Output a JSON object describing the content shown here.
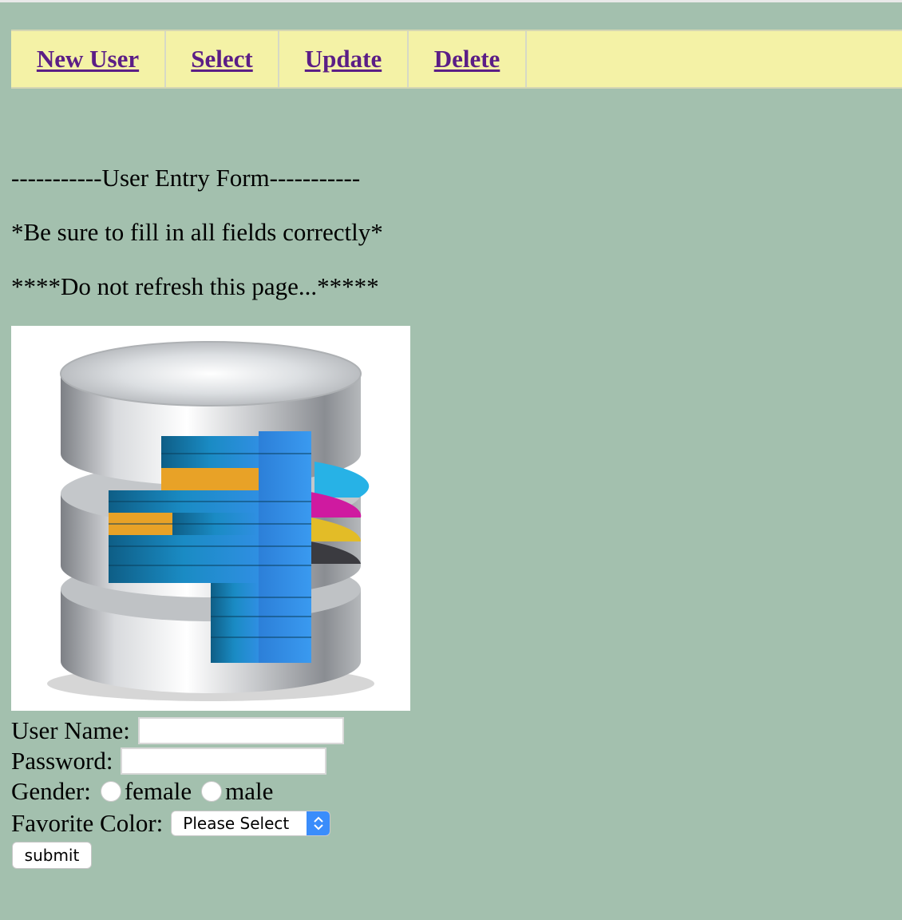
{
  "nav": {
    "items": [
      {
        "label": "New User"
      },
      {
        "label": "Select"
      },
      {
        "label": "Update"
      },
      {
        "label": "Delete"
      }
    ]
  },
  "header": {
    "line1": "-----------User Entry Form-----------",
    "line2": "*Be sure to fill in all fields correctly*",
    "line3": "****Do not refresh this page...*****"
  },
  "image": {
    "icon": "database-icon"
  },
  "form": {
    "username_label": "User Name:",
    "username_value": "",
    "password_label": "Password:",
    "password_value": "",
    "gender_label": "Gender:",
    "gender_options": [
      "female",
      "male"
    ],
    "color_label": "Favorite Color:",
    "color_selected": "Please Select",
    "submit_label": "submit"
  },
  "colors": {
    "background": "#a3c0ae",
    "nav_background": "#f4f2a6",
    "link": "#5b1e86",
    "select_accent": "#3a8dfb"
  }
}
